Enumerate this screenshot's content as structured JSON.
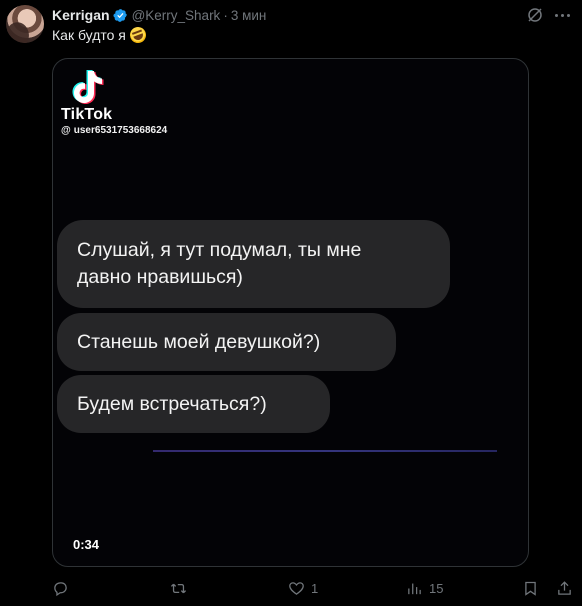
{
  "tweet": {
    "author_name": "Kerrigan",
    "handle": "@Kerry_Shark",
    "separator": "·",
    "time": "3 мин",
    "text": "Как будто я"
  },
  "media": {
    "brand": "TikTok",
    "username": "user6531753668624",
    "at_symbol": "@",
    "messages": [
      [
        "Слушай, я тут подумал, ты мне",
        "давно нравишься)"
      ],
      "Станешь моей девушкой?)",
      "Будем встречаться?)"
    ],
    "duration": "0:34"
  },
  "actions": {
    "likes": "1",
    "views": "15"
  },
  "colors": {
    "background": "#000000",
    "bubble": "#262628",
    "secondary_text": "#71767b",
    "verified": "#1d9bf0"
  },
  "icons": [
    "verified-badge-icon",
    "grok-icon",
    "more-icon",
    "reply-icon",
    "retweet-icon",
    "like-icon",
    "views-icon",
    "bookmark-icon",
    "share-icon",
    "tiktok-logo-icon"
  ]
}
